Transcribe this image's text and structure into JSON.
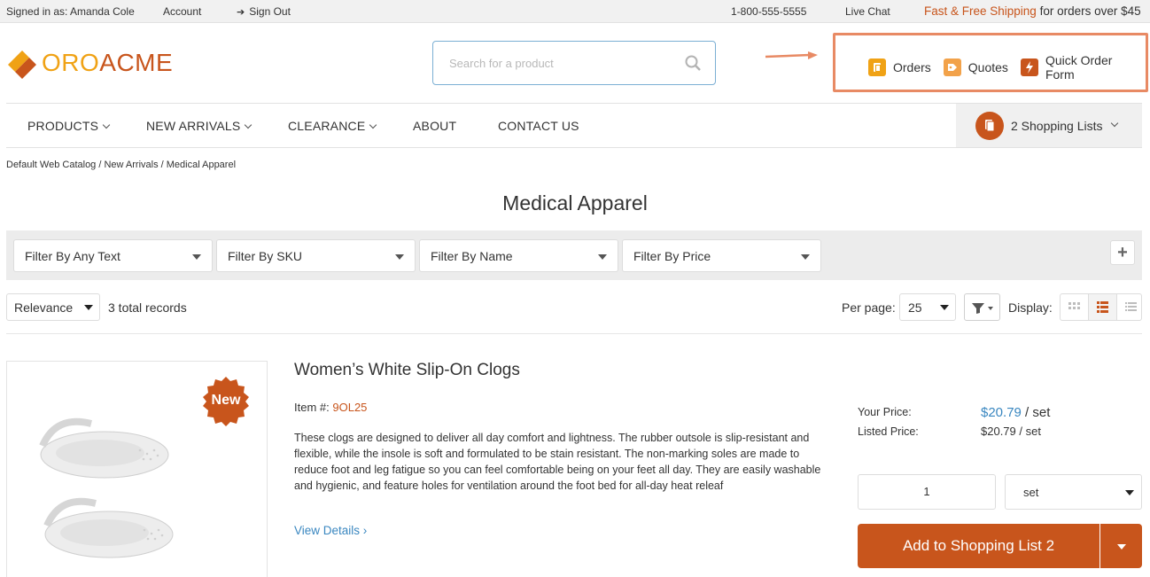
{
  "topbar": {
    "signed_in": "Signed in as: Amanda Cole",
    "account": "Account",
    "sign_out": "Sign Out",
    "phone": "1-800-555-5555",
    "live_chat": "Live Chat",
    "shipping_highlight": "Fast & Free Shipping",
    "shipping_rest": "for orders over $45"
  },
  "logo": {
    "part1": "ORO",
    "part2": "ACME"
  },
  "search": {
    "placeholder": "Search for a product"
  },
  "quick_links": [
    {
      "label": "Orders",
      "icon": "orders-icon",
      "color": "#f0a215"
    },
    {
      "label": "Quotes",
      "icon": "quotes-icon",
      "color": "#f2a24a"
    },
    {
      "label": "Quick Order Form",
      "icon": "quick-order-icon",
      "color": "#c8551c"
    }
  ],
  "nav": {
    "items": [
      {
        "label": "PRODUCTS"
      },
      {
        "label": "NEW ARRIVALS"
      },
      {
        "label": "CLEARANCE"
      },
      {
        "label": "ABOUT"
      },
      {
        "label": "CONTACT US"
      }
    ],
    "shopping_lists": "2 Shopping Lists"
  },
  "breadcrumb": "Default Web Catalog / New Arrivals / Medical Apparel",
  "page_title": "Medical Apparel",
  "filters": [
    {
      "label": "Filter By Any Text"
    },
    {
      "label": "Filter By SKU"
    },
    {
      "label": "Filter By Name"
    },
    {
      "label": "Filter By Price"
    }
  ],
  "toolbar": {
    "sort": "Relevance",
    "records": "3 total records",
    "per_page_label": "Per page:",
    "per_page": "25",
    "display_label": "Display:"
  },
  "product": {
    "badge": "New",
    "title": "Women’s White Slip-On Clogs",
    "item_label": "Item #:",
    "sku": "9OL25",
    "description": "These clogs are designed to deliver all day comfort and lightness. The rubber outsole is slip-resistant and flexible, while the insole is soft and formulated to be stain resistant. The non-marking soles are made to reduce foot and leg fatigue so you can feel comfortable being on your feet all day. They are easily washable and hygienic, and feature holes for ventilation around the foot bed for all-day heat releaf",
    "view_details": "View Details ›",
    "your_price_label": "Your Price:",
    "your_price": "$20.79",
    "your_price_unit": " / set",
    "listed_price_label": "Listed Price:",
    "listed_price": "$20.79 / set",
    "quantity": "1",
    "unit": "set",
    "add_button": "Add to Shopping List 2"
  },
  "colors": {
    "brand_orange": "#c8551c",
    "brand_yellow": "#f0a215",
    "link_blue": "#3a87c0"
  }
}
